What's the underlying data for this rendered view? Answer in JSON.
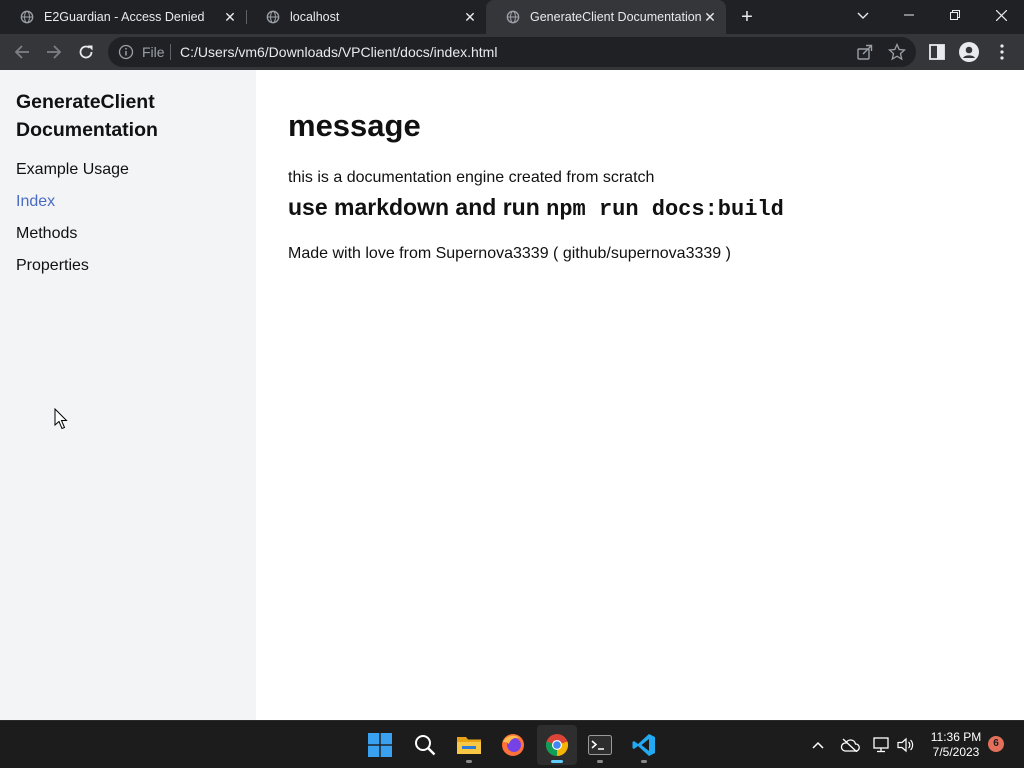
{
  "browser": {
    "tabs": [
      {
        "title": "E2Guardian - Access Denied",
        "active": false
      },
      {
        "title": "localhost",
        "active": false
      },
      {
        "title": "GenerateClient Documentation",
        "active": true
      }
    ],
    "address": {
      "scheme_label": "File",
      "url": "C:/Users/vm6/Downloads/VPClient/docs/index.html"
    }
  },
  "sidebar": {
    "title": "GenerateClient Documentation",
    "links": [
      {
        "label": "Example Usage",
        "active": false
      },
      {
        "label": "Index",
        "active": true
      },
      {
        "label": "Methods",
        "active": false
      },
      {
        "label": "Properties",
        "active": false
      }
    ],
    "active_link_color": "#4a6bc4"
  },
  "content": {
    "heading": "message",
    "paragraph": "this is a documentation engine created from scratch",
    "subheading_prefix": "use markdown and run ",
    "subheading_code": "npm run docs:build",
    "credits": "Made with love from Supernova3339 ( github/supernova3339 )"
  },
  "taskbar": {
    "apps": [
      "start-icon",
      "search-icon",
      "file-explorer-icon",
      "firefox-icon",
      "chrome-icon",
      "terminal-icon",
      "vscode-icon"
    ],
    "active_app": "chrome-icon",
    "clock": {
      "time": "11:36 PM",
      "date": "7/5/2023"
    },
    "notification_count": "6"
  },
  "colors": {
    "tab_active": "#35363a",
    "tabstrip": "#202124",
    "sidebar_bg": "#f3f4f6",
    "taskbar": "#1c1c1c"
  }
}
